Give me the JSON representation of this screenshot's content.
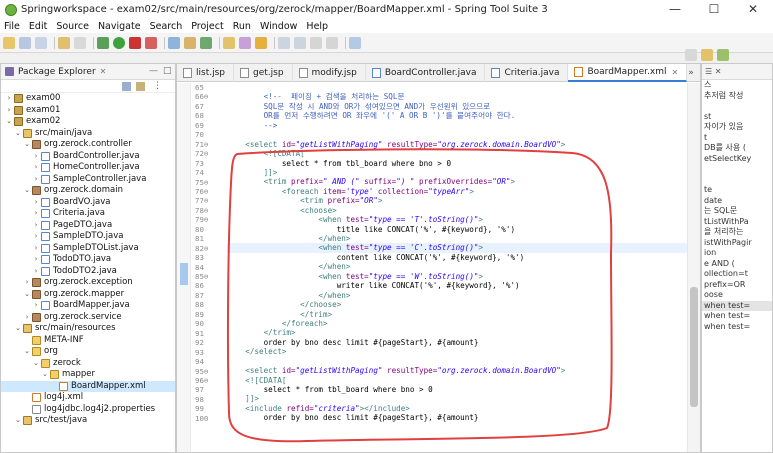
{
  "window": {
    "title": "Springworkspace - exam02/src/main/resources/org/zerock/mapper/BoardMapper.xml - Spring Tool Suite 3",
    "minimize": "—",
    "maximize": "☐",
    "close": "✕"
  },
  "menu": [
    "File",
    "Edit",
    "Source",
    "Navigate",
    "Search",
    "Project",
    "Run",
    "Window",
    "Help"
  ],
  "explorer": {
    "title": "Package Explorer",
    "items": [
      {
        "label": "exam00",
        "depth": 0,
        "twisty": "›",
        "icon": "project"
      },
      {
        "label": "exam01",
        "depth": 0,
        "twisty": "›",
        "icon": "project"
      },
      {
        "label": "exam02",
        "depth": 0,
        "twisty": "⌄",
        "icon": "project"
      },
      {
        "label": "src/main/java",
        "depth": 1,
        "twisty": "⌄",
        "icon": "srcfolder"
      },
      {
        "label": "org.zerock.controller",
        "depth": 2,
        "twisty": "⌄",
        "icon": "package"
      },
      {
        "label": "BoardController.java",
        "depth": 3,
        "twisty": "›",
        "icon": "java"
      },
      {
        "label": "HomeController.java",
        "depth": 3,
        "twisty": "›",
        "icon": "java"
      },
      {
        "label": "SampleController.java",
        "depth": 3,
        "twisty": "›",
        "icon": "java"
      },
      {
        "label": "org.zerock.domain",
        "depth": 2,
        "twisty": "⌄",
        "icon": "package"
      },
      {
        "label": "BoardVO.java",
        "depth": 3,
        "twisty": "›",
        "icon": "java"
      },
      {
        "label": "Criteria.java",
        "depth": 3,
        "twisty": "›",
        "icon": "java"
      },
      {
        "label": "PageDTO.java",
        "depth": 3,
        "twisty": "›",
        "icon": "java"
      },
      {
        "label": "SampleDTO.java",
        "depth": 3,
        "twisty": "›",
        "icon": "java"
      },
      {
        "label": "SampleDTOList.java",
        "depth": 3,
        "twisty": "›",
        "icon": "java"
      },
      {
        "label": "TodoDTO.java",
        "depth": 3,
        "twisty": "›",
        "icon": "java"
      },
      {
        "label": "TodoDTO2.java",
        "depth": 3,
        "twisty": "›",
        "icon": "java"
      },
      {
        "label": "org.zerock.exception",
        "depth": 2,
        "twisty": "›",
        "icon": "package"
      },
      {
        "label": "org.zerock.mapper",
        "depth": 2,
        "twisty": "⌄",
        "icon": "package"
      },
      {
        "label": "BoardMapper.java",
        "depth": 3,
        "twisty": "›",
        "icon": "java"
      },
      {
        "label": "org.zerock.service",
        "depth": 2,
        "twisty": "›",
        "icon": "package"
      },
      {
        "label": "src/main/resources",
        "depth": 1,
        "twisty": "⌄",
        "icon": "srcfolder"
      },
      {
        "label": "META-INF",
        "depth": 2,
        "twisty": "",
        "icon": "folder"
      },
      {
        "label": "org",
        "depth": 2,
        "twisty": "⌄",
        "icon": "folder"
      },
      {
        "label": "zerock",
        "depth": 3,
        "twisty": "⌄",
        "icon": "folder"
      },
      {
        "label": "mapper",
        "depth": 4,
        "twisty": "⌄",
        "icon": "folder"
      },
      {
        "label": "BoardMapper.xml",
        "depth": 5,
        "twisty": "",
        "icon": "xml",
        "selected": true
      },
      {
        "label": "log4j.xml",
        "depth": 2,
        "twisty": "",
        "icon": "xml"
      },
      {
        "label": "log4jdbc.log4j2.properties",
        "depth": 2,
        "twisty": "",
        "icon": "props"
      },
      {
        "label": "src/test/java",
        "depth": 1,
        "twisty": "⌄",
        "icon": "srcfolder"
      }
    ]
  },
  "editor": {
    "tabs": [
      {
        "label": "list.jsp",
        "type": "jsp",
        "active": false
      },
      {
        "label": "get.jsp",
        "type": "jsp",
        "active": false
      },
      {
        "label": "modify.jsp",
        "type": "jsp",
        "active": false
      },
      {
        "label": "BoardController.java",
        "type": "java",
        "active": false
      },
      {
        "label": "Criteria.java",
        "type": "java",
        "active": false
      },
      {
        "label": "BoardMapper.xml",
        "type": "xml",
        "active": true
      }
    ],
    "tab_overflow": "»",
    "lines": [
      {
        "n": "65",
        "segs": [
          {
            "c": "plain",
            "t": ""
          }
        ]
      },
      {
        "n": "66⊖",
        "segs": [
          {
            "c": "cmt",
            "t": "        <!--  페이징 + 검색을 처리하는 SQL문"
          }
        ]
      },
      {
        "n": "67",
        "segs": [
          {
            "c": "cmt",
            "t": "        SQL문 작성 시 AND와 OR가 섞여있으면 AND가 우선원위 있으므로"
          }
        ]
      },
      {
        "n": "68",
        "segs": [
          {
            "c": "cmt",
            "t": "        OR를 먼저 수행하려면 OR 좌우에 '(' A OR B ')'를 붙여주어야 한다."
          }
        ]
      },
      {
        "n": "69",
        "segs": [
          {
            "c": "cmt",
            "t": "        -->"
          }
        ]
      },
      {
        "n": "70",
        "segs": [
          {
            "c": "plain",
            "t": ""
          }
        ]
      },
      {
        "n": "71⊖",
        "segs": [
          {
            "c": "kw",
            "t": "    <select "
          },
          {
            "c": "attr",
            "t": "id="
          },
          {
            "c": "str",
            "t": "\"getListWithPaging\""
          },
          {
            "c": "attr",
            "t": " resultType="
          },
          {
            "c": "str",
            "t": "\"org.zerock.domain.BoardVO\""
          },
          {
            "c": "kw",
            "t": ">"
          }
        ]
      },
      {
        "n": "72⊖",
        "segs": [
          {
            "c": "cdata",
            "t": "        <![CDATA["
          }
        ]
      },
      {
        "n": "73",
        "segs": [
          {
            "c": "plain",
            "t": "            select * from tbl_board where bno > 0"
          }
        ]
      },
      {
        "n": "74",
        "segs": [
          {
            "c": "cdata",
            "t": "        ]]>"
          }
        ]
      },
      {
        "n": "75⊖",
        "segs": [
          {
            "c": "kw",
            "t": "        <trim "
          },
          {
            "c": "attr",
            "t": "prefix="
          },
          {
            "c": "str",
            "t": "\" AND (\""
          },
          {
            "c": "attr",
            "t": " suffix="
          },
          {
            "c": "str",
            "t": "\") \""
          },
          {
            "c": "attr",
            "t": " prefixOverrides="
          },
          {
            "c": "str",
            "t": "\"OR\""
          },
          {
            "c": "kw",
            "t": ">"
          }
        ]
      },
      {
        "n": "76⊖",
        "segs": [
          {
            "c": "kw",
            "t": "            <foreach "
          },
          {
            "c": "attr",
            "t": "item="
          },
          {
            "c": "str",
            "t": "'type'"
          },
          {
            "c": "attr",
            "t": " collection="
          },
          {
            "c": "str",
            "t": "\"typeArr\""
          },
          {
            "c": "kw",
            "t": ">"
          }
        ]
      },
      {
        "n": "77⊖",
        "segs": [
          {
            "c": "kw",
            "t": "                <trim "
          },
          {
            "c": "attr",
            "t": "prefix="
          },
          {
            "c": "str",
            "t": "\"OR\""
          },
          {
            "c": "kw",
            "t": ">"
          }
        ]
      },
      {
        "n": "78⊖",
        "segs": [
          {
            "c": "kw",
            "t": "                <choose>"
          }
        ]
      },
      {
        "n": "79⊖",
        "segs": [
          {
            "c": "kw",
            "t": "                    <when "
          },
          {
            "c": "attr",
            "t": "test="
          },
          {
            "c": "str",
            "t": "\"type == 'T'.toString()\""
          },
          {
            "c": "kw",
            "t": ">"
          }
        ]
      },
      {
        "n": "80",
        "segs": [
          {
            "c": "plain",
            "t": "                        title like CONCAT('%', #{keyword}, '%')"
          }
        ]
      },
      {
        "n": "81",
        "segs": [
          {
            "c": "kw",
            "t": "                    </when>"
          }
        ]
      },
      {
        "n": "82⊖",
        "segs": [
          {
            "c": "kw",
            "t": "                    <when "
          },
          {
            "c": "attr",
            "t": "test="
          },
          {
            "c": "str",
            "t": "\"type == 'C'.toString()\""
          },
          {
            "c": "kw",
            "t": ">"
          }
        ],
        "current": true
      },
      {
        "n": "83",
        "segs": [
          {
            "c": "plain",
            "t": "                        content like CONCAT('%', #{keyword}, '%')"
          }
        ]
      },
      {
        "n": "84",
        "segs": [
          {
            "c": "kw",
            "t": "                    </when>"
          }
        ]
      },
      {
        "n": "85⊖",
        "segs": [
          {
            "c": "kw",
            "t": "                    <when "
          },
          {
            "c": "attr",
            "t": "test="
          },
          {
            "c": "str",
            "t": "\"type == 'W'.toString()\""
          },
          {
            "c": "kw",
            "t": ">"
          }
        ]
      },
      {
        "n": "86",
        "segs": [
          {
            "c": "plain",
            "t": "                        writer like CONCAT('%', #{keyword}, '%')"
          }
        ]
      },
      {
        "n": "87",
        "segs": [
          {
            "c": "kw",
            "t": "                    </when>"
          }
        ]
      },
      {
        "n": "88",
        "segs": [
          {
            "c": "kw",
            "t": "                </choose>"
          }
        ]
      },
      {
        "n": "89",
        "segs": [
          {
            "c": "kw",
            "t": "                </trim>"
          }
        ]
      },
      {
        "n": "90",
        "segs": [
          {
            "c": "kw",
            "t": "            </foreach>"
          }
        ]
      },
      {
        "n": "91",
        "segs": [
          {
            "c": "kw",
            "t": "        </trim>"
          }
        ]
      },
      {
        "n": "92",
        "segs": [
          {
            "c": "plain",
            "t": "        order by bno desc limit #{pageStart}, #{amount}"
          }
        ]
      },
      {
        "n": "93",
        "segs": [
          {
            "c": "kw",
            "t": "    </select>"
          }
        ]
      },
      {
        "n": "94",
        "segs": [
          {
            "c": "plain",
            "t": ""
          }
        ]
      },
      {
        "n": "95⊖",
        "segs": [
          {
            "c": "kw",
            "t": "    <select "
          },
          {
            "c": "attr",
            "t": "id="
          },
          {
            "c": "str",
            "t": "\"getListWithPaging\""
          },
          {
            "c": "attr",
            "t": " resultType="
          },
          {
            "c": "str",
            "t": "\"org.zerock.domain.BoardVO\""
          },
          {
            "c": "kw",
            "t": ">"
          }
        ]
      },
      {
        "n": "96⊖",
        "segs": [
          {
            "c": "cdata",
            "t": "    <![CDATA["
          }
        ]
      },
      {
        "n": "97",
        "segs": [
          {
            "c": "plain",
            "t": "        select * from tbl_board where bno > 0"
          }
        ]
      },
      {
        "n": "98",
        "segs": [
          {
            "c": "cdata",
            "t": "    ]]>"
          }
        ]
      },
      {
        "n": "99",
        "segs": [
          {
            "c": "kw",
            "t": "    <include "
          },
          {
            "c": "attr",
            "t": "refid="
          },
          {
            "c": "str",
            "t": "\"criteria\""
          },
          {
            "c": "kw",
            "t": "></include>"
          }
        ]
      },
      {
        "n": "100",
        "segs": [
          {
            "c": "plain",
            "t": "        order by bno desc limit #{pageStart}, #{amount}"
          }
        ]
      }
    ]
  },
  "outline": {
    "lines": [
      "스",
      "추저럼 작성",
      "",
      "st",
      "자이가 있음",
      "t",
      "DB를 사용 (",
      "etSelectKey",
      "",
      "",
      "te",
      "date",
      "는 SQL문",
      "tListWithPa",
      "을 처리하는",
      "istWithPagir",
      "ion",
      "e AND (",
      "ollection=t",
      "prefix=OR",
      "oose",
      "when test=",
      "when test=",
      "when test="
    ]
  },
  "annotation": {
    "color": "#e04040"
  }
}
